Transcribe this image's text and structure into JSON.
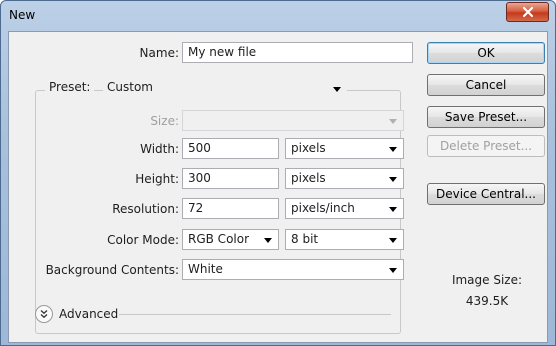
{
  "window": {
    "title": "New"
  },
  "form": {
    "name_label": "Name:",
    "name_value": "My new file",
    "preset_label": "Preset:",
    "preset_value": "Custom",
    "size_label": "Size:",
    "size_value": "",
    "width_label": "Width:",
    "width_value": "500",
    "width_unit": "pixels",
    "height_label": "Height:",
    "height_value": "300",
    "height_unit": "pixels",
    "resolution_label": "Resolution:",
    "resolution_value": "72",
    "resolution_unit": "pixels/inch",
    "colormode_label": "Color Mode:",
    "colormode_value": "RGB Color",
    "bitdepth_value": "8 bit",
    "background_label": "Background Contents:",
    "background_value": "White",
    "advanced_label": "Advanced"
  },
  "buttons": {
    "ok": "OK",
    "cancel": "Cancel",
    "save_preset": "Save Preset...",
    "delete_preset": "Delete Preset...",
    "device_central": "Device Central..."
  },
  "info": {
    "image_size_label": "Image Size:",
    "image_size_value": "439.5K"
  },
  "icons": {
    "close": "close-icon",
    "dropdown": "chevron-down-icon",
    "advanced_toggle": "double-chevron-down-icon"
  },
  "colors": {
    "close_button": "#c4391c",
    "default_button_border": "#3c7fb1"
  }
}
